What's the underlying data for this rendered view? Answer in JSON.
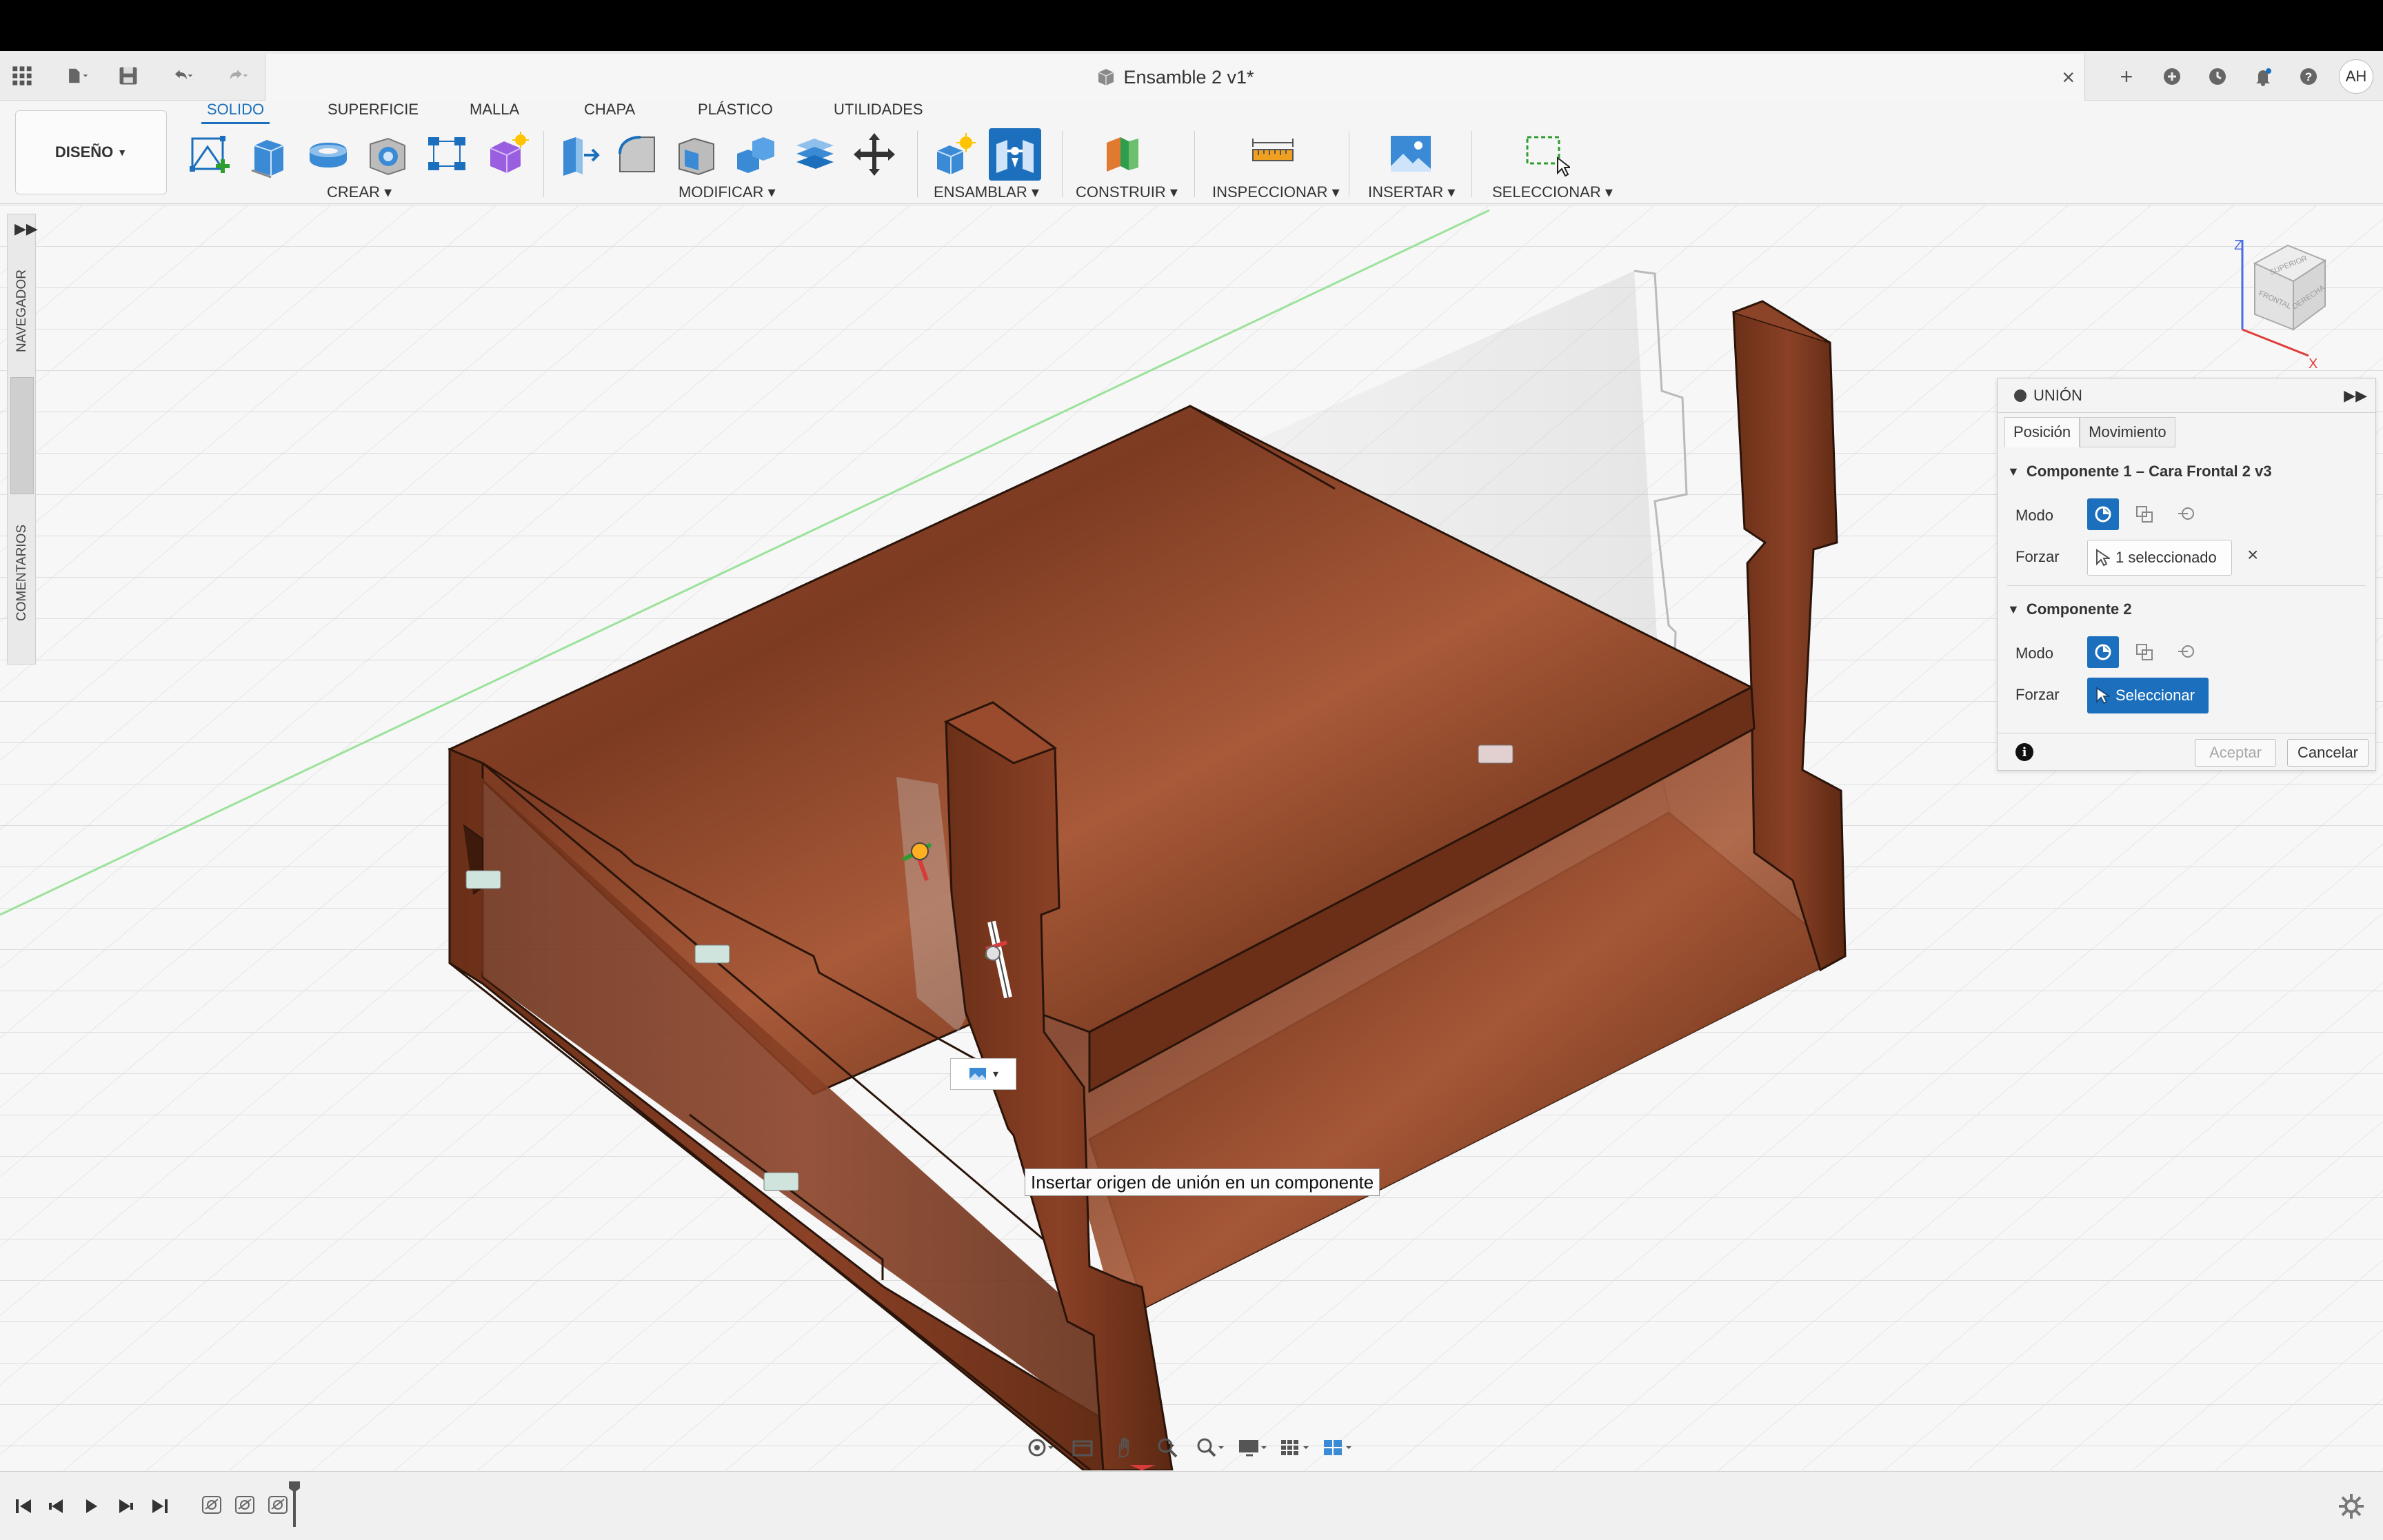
{
  "document": {
    "title": "Ensamble 2 v1*"
  },
  "user": {
    "initials": "AH"
  },
  "workspace": {
    "label": "DISEÑO"
  },
  "tabs": [
    "SOLIDO",
    "SUPERFICIE",
    "MALLA",
    "CHAPA",
    "PLÁSTICO",
    "UTILIDADES"
  ],
  "groups": {
    "crear": "CREAR",
    "modificar": "MODIFICAR",
    "ensamblar": "ENSAMBLAR",
    "construir": "CONSTRUIR",
    "inspeccionar": "INSPECCIONAR",
    "insertar": "INSERTAR",
    "seleccionar": "SELECCIONAR"
  },
  "side": {
    "navegador": "NAVEGADOR",
    "comentarios": "COMENTARIOS"
  },
  "viewcube": {
    "axis_z": "Z",
    "axis_x": "X",
    "face_top": "SUPERIOR",
    "face_front": "FRONTAL",
    "face_right": "DERECHA"
  },
  "panel": {
    "title": "UNIÓN",
    "tab_position": "Posición",
    "tab_motion": "Movimiento",
    "comp1": "Componente 1 – Cara Frontal 2 v3",
    "comp2": "Componente 2",
    "mode_label": "Modo",
    "force_label": "Forzar",
    "comp1_selection": "1 seleccionado",
    "comp2_selection": "Seleccionar",
    "accept": "Aceptar",
    "cancel": "Cancelar"
  },
  "tooltip": "Insertar origen de unión en un componente",
  "colors": {
    "accent": "#1b6fbd",
    "wood_dark": "#5a2a15",
    "wood_mid": "#8a4427",
    "wood_light": "#a7573a"
  }
}
